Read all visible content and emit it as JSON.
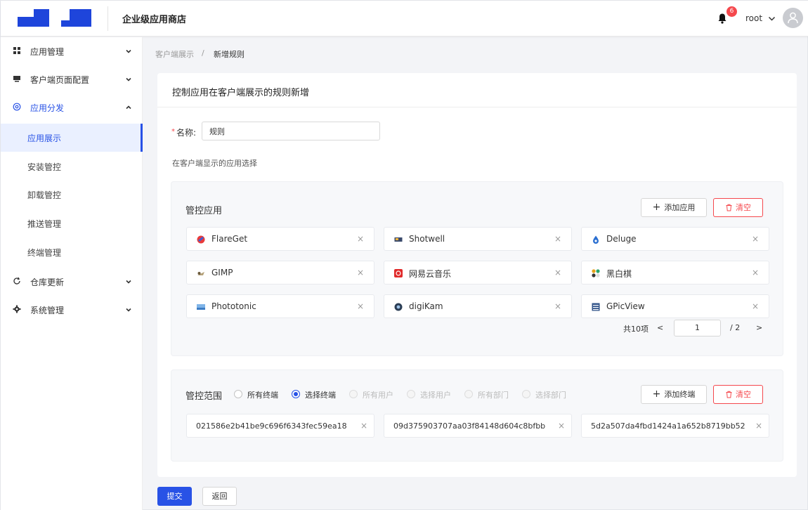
{
  "header": {
    "app_title": "企业级应用商店",
    "notification_count": "6",
    "user_name": "root"
  },
  "sidebar": {
    "items": [
      {
        "label": "应用管理",
        "icon": "grid-icon"
      },
      {
        "label": "客户端页面配置",
        "icon": "monitor-icon"
      },
      {
        "label": "应用分发",
        "icon": "distribute-icon"
      },
      {
        "label": "应用展示"
      },
      {
        "label": "安装管控"
      },
      {
        "label": "卸载管控"
      },
      {
        "label": "推送管理"
      },
      {
        "label": "终端管理"
      },
      {
        "label": "仓库更新",
        "icon": "refresh-icon"
      },
      {
        "label": "系统管理",
        "icon": "gear-icon"
      }
    ]
  },
  "breadcrumb": {
    "parent": "客户端展示",
    "separator": "/",
    "current": "新增规则"
  },
  "form": {
    "card_title": "控制应用在客户端展示的规则新增",
    "required_mark": "*",
    "name_label": "名称:",
    "name_value": "规则",
    "section_hint": "在客户端显示的应用选择"
  },
  "apps_panel": {
    "title": "管控应用",
    "add_label": "添加应用",
    "clear_label": "清空",
    "remove_glyph": "×",
    "apps": [
      {
        "name": "FlareGet",
        "icon": "flareget-icon"
      },
      {
        "name": "Shotwell",
        "icon": "shotwell-icon"
      },
      {
        "name": "Deluge",
        "icon": "deluge-icon"
      },
      {
        "name": "GIMP",
        "icon": "gimp-icon"
      },
      {
        "name": "网易云音乐",
        "icon": "netease-music-icon"
      },
      {
        "name": "黑白棋",
        "icon": "reversi-icon"
      },
      {
        "name": "Phototonic",
        "icon": "phototonic-icon"
      },
      {
        "name": "digiKam",
        "icon": "digikam-icon"
      },
      {
        "name": "GPicView",
        "icon": "gpicview-icon"
      }
    ],
    "pagination": {
      "total": "共10项",
      "prev": "<",
      "current_page": "1",
      "total_pages": "/ 2",
      "next": ">"
    }
  },
  "scope_panel": {
    "title": "管控范围",
    "options": [
      {
        "label": "所有终端",
        "state": "unchecked"
      },
      {
        "label": "选择终端",
        "state": "checked"
      },
      {
        "label": "所有用户",
        "state": "disabled"
      },
      {
        "label": "选择用户",
        "state": "disabled"
      },
      {
        "label": "所有部门",
        "state": "disabled"
      },
      {
        "label": "选择部门",
        "state": "disabled"
      }
    ],
    "add_label": "添加终端",
    "clear_label": "清空",
    "terminals": [
      "021586e2b41be9c696f6343fec59ea18",
      "09d375903707aa03f84148d604c8bfbb",
      "5d2a507da4fbd1424a1a652b8719bb52"
    ]
  },
  "footer": {
    "submit_label": "提交",
    "back_label": "返回"
  },
  "colors": {
    "primary": "#2852e6",
    "danger": "#f5484d",
    "logo": "#1e45db"
  }
}
